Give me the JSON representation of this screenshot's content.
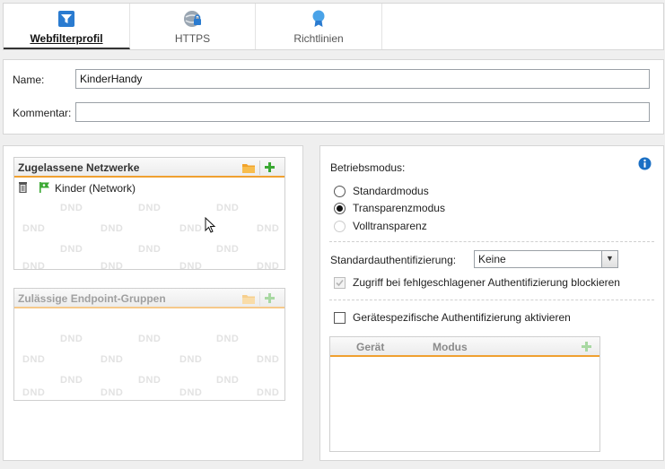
{
  "tabs": [
    {
      "label": "Webfilterprofil",
      "icon": "filter-icon",
      "active": true
    },
    {
      "label": "HTTPS",
      "icon": "https-globe-icon",
      "active": false
    },
    {
      "label": "Richtlinien",
      "icon": "badge-icon",
      "active": false
    }
  ],
  "form": {
    "name_label": "Name:",
    "name_value": "KinderHandy",
    "comment_label": "Kommentar:",
    "comment_value": ""
  },
  "networks": {
    "title": "Zugelassene Netzwerke",
    "items": [
      {
        "label": "Kinder (Network)",
        "icon": "network-flag-icon"
      }
    ],
    "watermark": "DND"
  },
  "endpoints": {
    "title": "Zulässige Endpoint-Gruppen",
    "watermark": "DND"
  },
  "mode": {
    "label": "Betriebsmodus:",
    "options": [
      {
        "label": "Standardmodus",
        "selected": false,
        "disabled": false
      },
      {
        "label": "Transparenzmodus",
        "selected": true,
        "disabled": false
      },
      {
        "label": "Volltransparenz",
        "selected": false,
        "disabled": true
      }
    ]
  },
  "auth": {
    "label": "Standardauthentifizierung:",
    "value": "Keine",
    "block_label": "Zugriff bei fehlgeschlagener Authentifizierung blockieren",
    "device_label": "Gerätespezifische Authentifizierung aktivieren"
  },
  "device_table": {
    "columns": [
      "Gerät",
      "Modus"
    ]
  },
  "colors": {
    "accent": "#f0a030",
    "add_green": "#3aa832",
    "info_blue": "#1a6fc4"
  }
}
